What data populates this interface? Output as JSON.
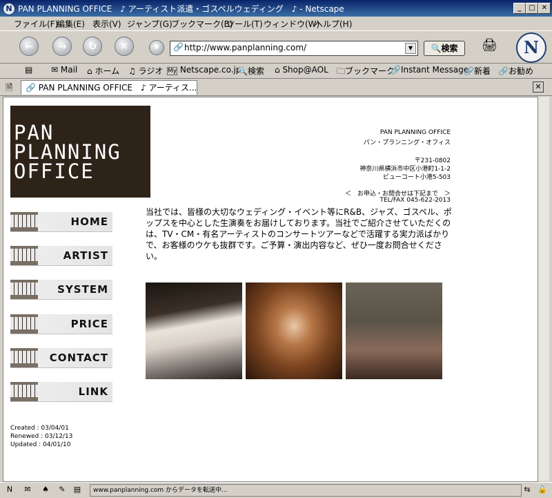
{
  "window": {
    "title": "PAN PLANNING OFFICE　♪ アーティスト派遣・ゴスペルウェディング　♪ - Netscape",
    "app_icon": "N"
  },
  "menu": {
    "items": [
      "ファイル(F)",
      "編集(E)",
      "表示(V)",
      "ジャンプ(G)",
      "ブックマーク(B)",
      "ツール(T)",
      "ウィンドウ(W)",
      "ヘルプ(H)"
    ]
  },
  "nav": {
    "url": "http://www.panplanning.com/",
    "search_label": "検索",
    "logo_letter": "N"
  },
  "personal_toolbar": {
    "items": [
      "Mail",
      "ホーム",
      "ラジオ",
      "Netscape.co.jp",
      "検索",
      "Shop@AOL",
      "ブックマーク",
      "Instant Message",
      "新着",
      "お勧め"
    ]
  },
  "tab": {
    "title": "PAN PLANNING OFFICE　♪ アーティス..."
  },
  "page": {
    "logo_lines": [
      "PAN",
      "PLANNING",
      "OFFICE"
    ],
    "company_name_en": "PAN PLANNING OFFICE",
    "company_name_ja": "パン・プランニング・オフィス",
    "postal": "〒231-0802",
    "address1": "神奈川県横浜市中区小港町1-1-2",
    "address2": "ビューコート小港5-503",
    "contact_lead": "＜　お申込・お問合せは下記まで　＞",
    "tel": "TEL/FAX 045-622-2013",
    "nav_items": [
      "HOME",
      "ARTIST",
      "SYSTEM",
      "PRICE",
      "CONTACT",
      "LINK"
    ],
    "intro": "当社では、皆様の大切なウェディング・イベント等にR&B、ジャズ、ゴスペル、ポップスを中心とした生演奏をお届けしております。当社でご紹介させていただくのは、TV・CM・有名アーティストのコンサートツアーなどで活躍する実力派ばかりで、お客様のウケも抜群です。ご予算・演出内容など、ぜひ一度お問合せください。",
    "created": "Created : 03/04/01",
    "renewed": "Renewed : 03/12/13",
    "updated": "Updated : 04/01/10"
  },
  "status": {
    "text": "www.panplanning.com からデータを転送中..."
  }
}
